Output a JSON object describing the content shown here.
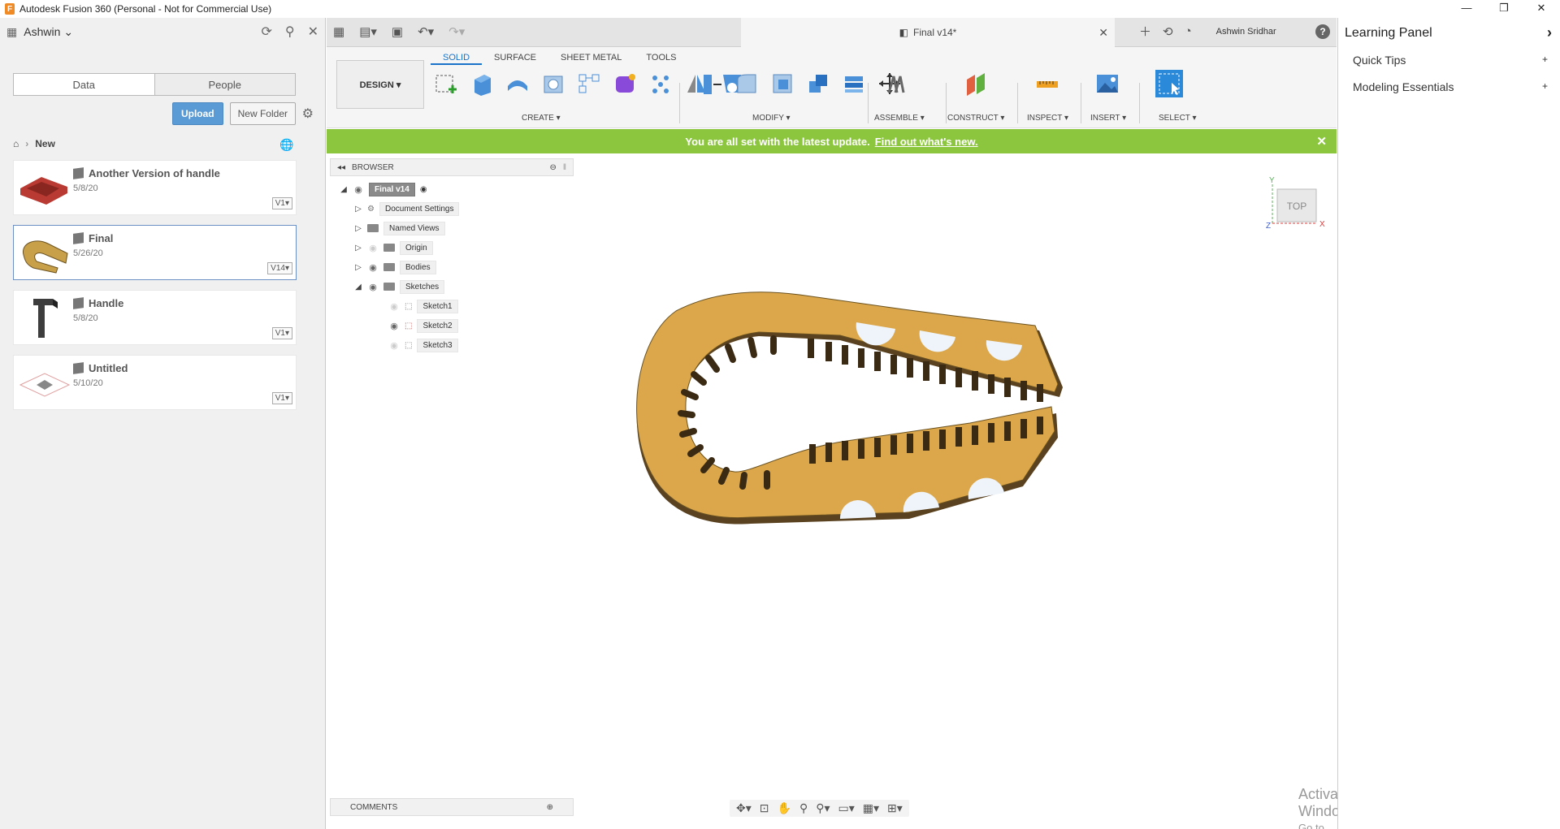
{
  "window": {
    "title": "Autodesk Fusion 360 (Personal - Not for Commercial Use)",
    "app_icon_letter": "F",
    "controls": [
      "—",
      "❐",
      "✕"
    ]
  },
  "data_panel": {
    "user": "Ashwin",
    "tabs": [
      "Data",
      "People"
    ],
    "upload_label": "Upload",
    "new_folder_label": "New Folder",
    "breadcrumb": "New",
    "files": [
      {
        "name": "Another Version of handle",
        "date": "5/8/20",
        "version": "V1",
        "thumb_color": "#b83a32"
      },
      {
        "name": "Final",
        "date": "5/26/20",
        "version": "V14",
        "thumb_color": "#c9a04a",
        "selected": true
      },
      {
        "name": "Handle",
        "date": "5/8/20",
        "version": "V1",
        "thumb_color": "#3d3d3d"
      },
      {
        "name": "Untitled",
        "date": "5/10/20",
        "version": "V1",
        "thumb_color": "#d8a0a0"
      }
    ]
  },
  "doc_tab": {
    "title": "Final v14*"
  },
  "user_name": "Ashwin Sridhar",
  "toolbar": {
    "design_label": "DESIGN ▾",
    "workspace_tabs": [
      "SOLID",
      "SURFACE",
      "SHEET METAL",
      "TOOLS"
    ],
    "active_tab": "SOLID",
    "groups": {
      "create": "CREATE ▾",
      "modify": "MODIFY ▾",
      "assemble": "ASSEMBLE ▾",
      "construct": "CONSTRUCT ▾",
      "inspect": "INSPECT ▾",
      "insert": "INSERT ▾",
      "select": "SELECT ▾"
    }
  },
  "banner": {
    "text": "You are all set with the latest update.",
    "link": "Find out what's new."
  },
  "browser": {
    "title": "BROWSER",
    "root": "Final v14",
    "nodes": [
      "Document Settings",
      "Named Views",
      "Origin",
      "Bodies",
      "Sketches",
      "Sketch1",
      "Sketch2",
      "Sketch3"
    ]
  },
  "viewcube": {
    "face": "TOP",
    "axis_x": "X",
    "axis_y": "Y",
    "axis_z": "Z"
  },
  "comments_label": "COMMENTS",
  "watermark": {
    "line1": "Activate Windows",
    "line2": "Go to Settings to activate Windows."
  },
  "learning_panel": {
    "title": "Learning Panel",
    "items": [
      "Quick Tips",
      "Modeling Essentials"
    ]
  },
  "colors": {
    "accent": "#1a73c8",
    "banner": "#8cc63f",
    "model_fill": "#dba74a",
    "model_edge": "#5a4220"
  }
}
